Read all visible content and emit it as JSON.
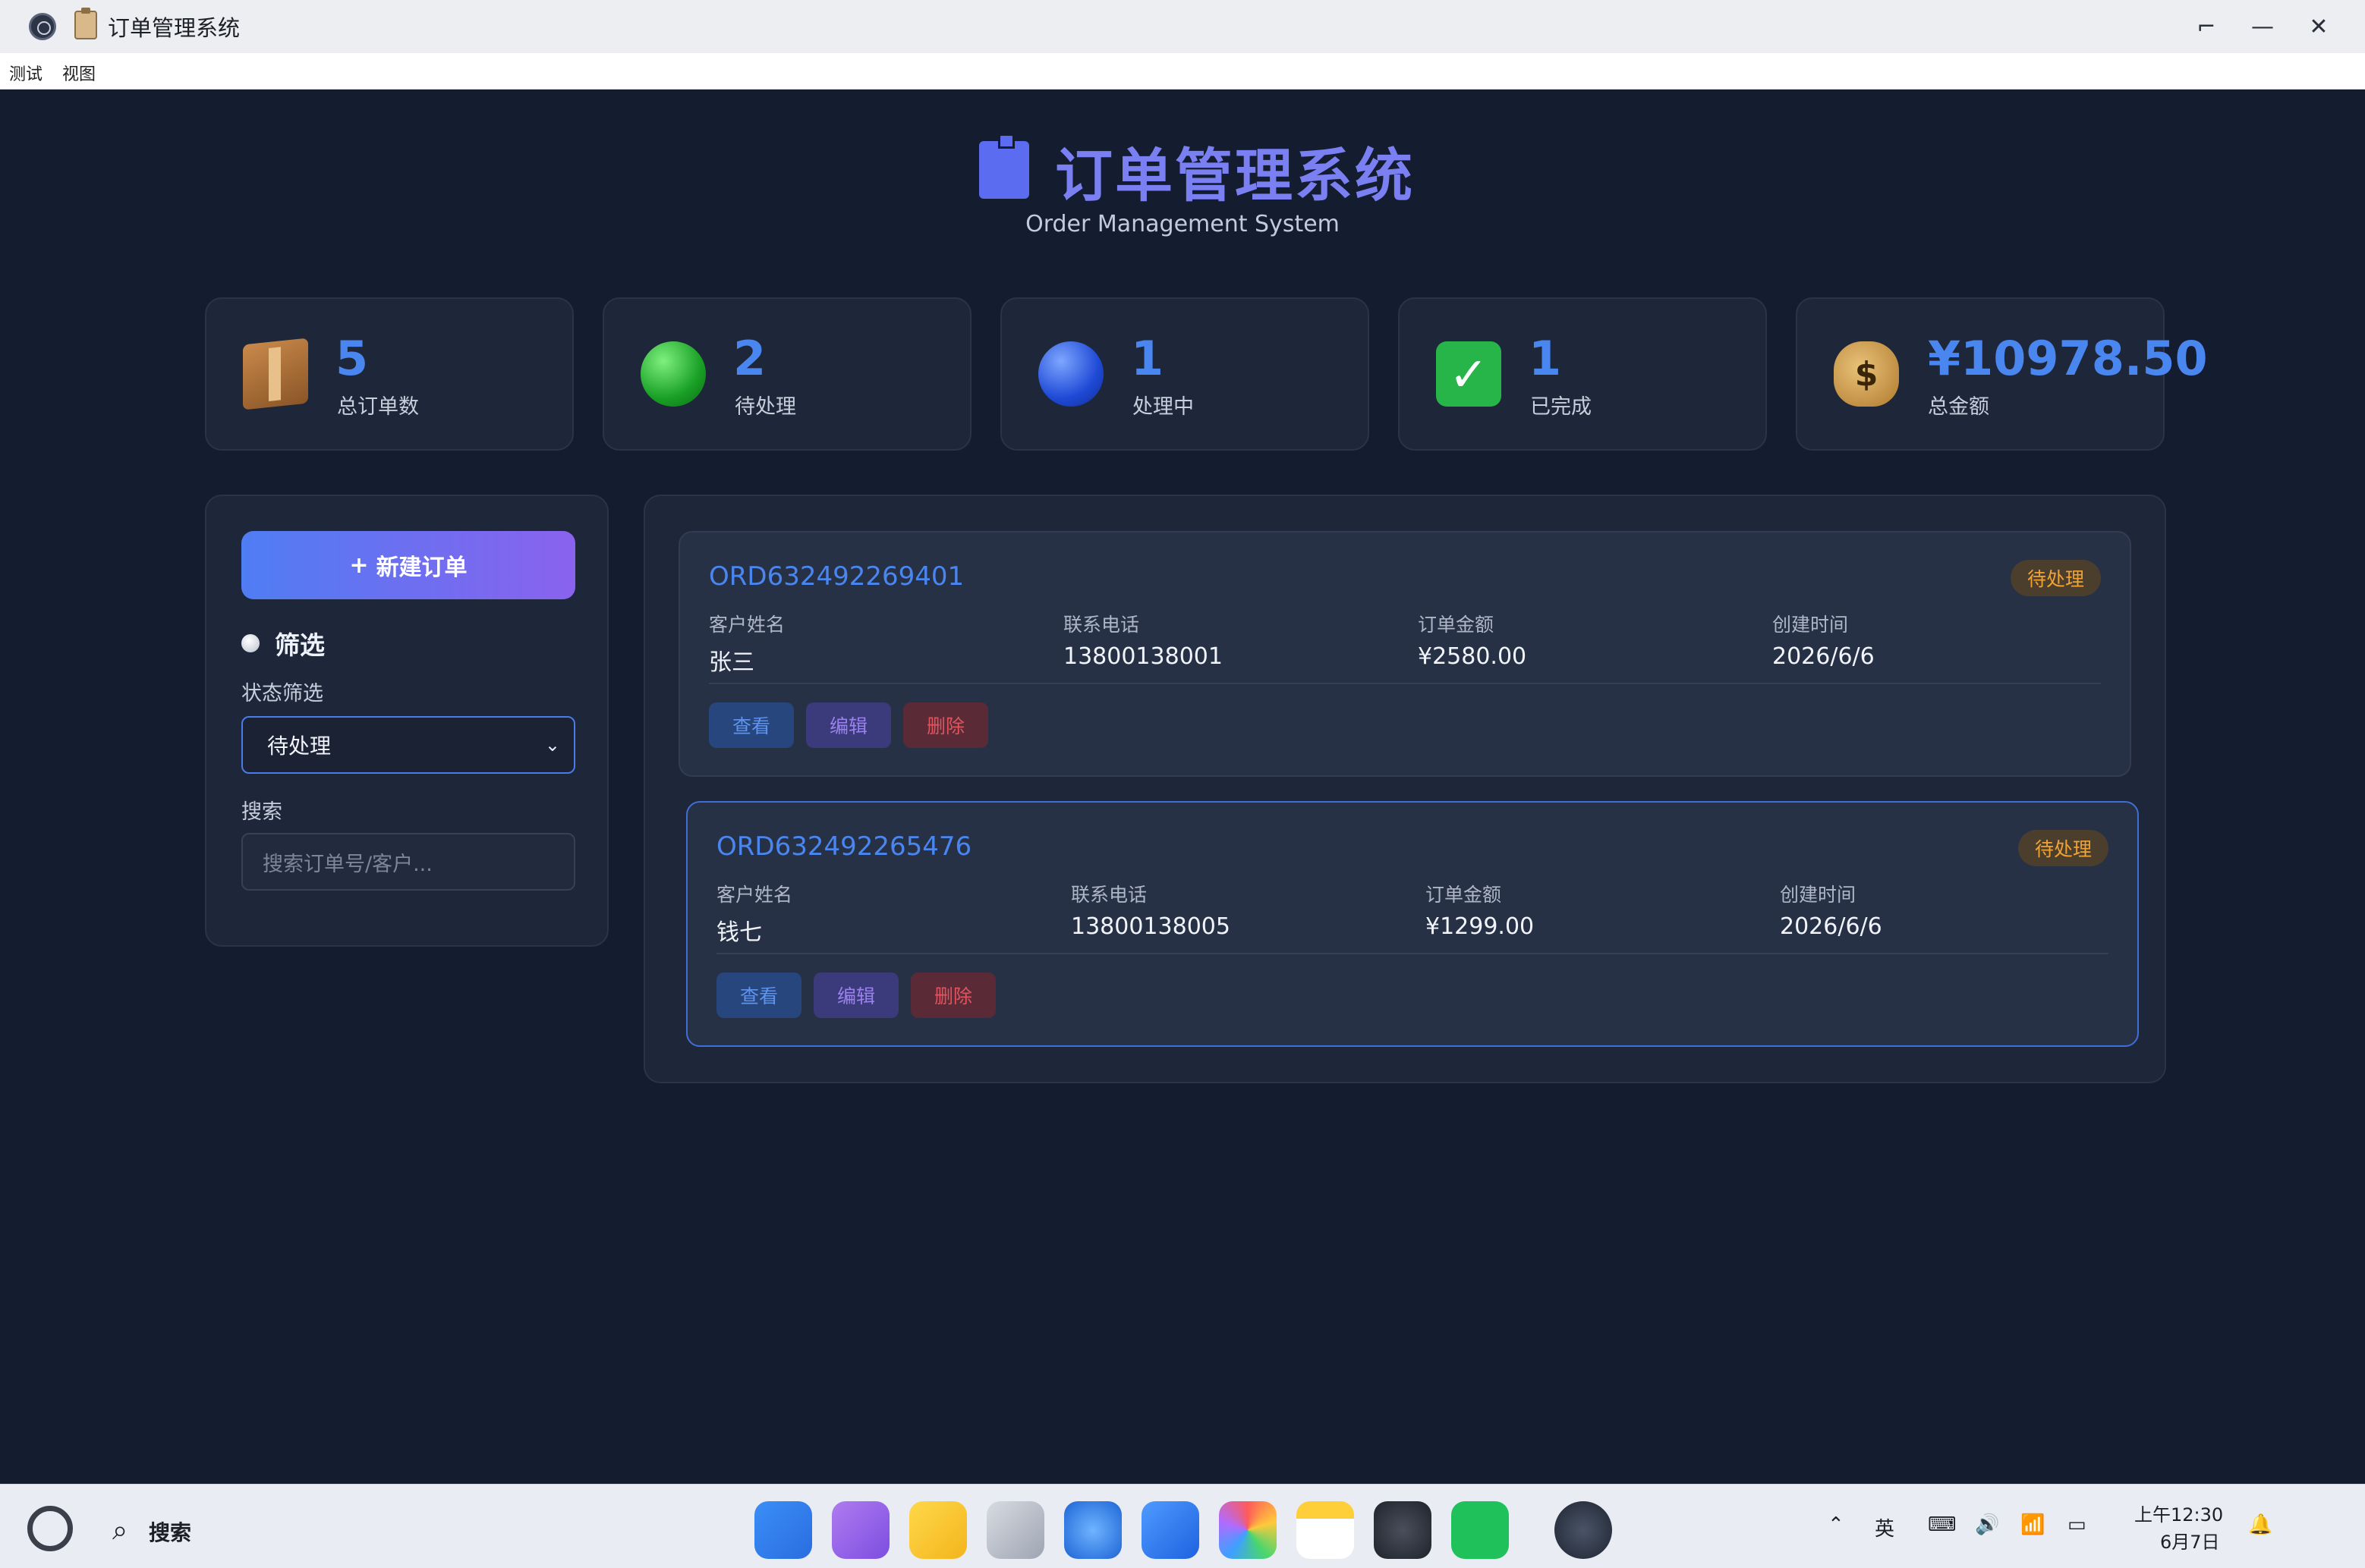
{
  "window": {
    "title": "订单管理系统",
    "menu": [
      "测试",
      "视图"
    ],
    "controls": {
      "restore": "⌐",
      "minimize": "—",
      "close": "✕"
    }
  },
  "header": {
    "title": "订单管理系统",
    "subtitle": "Order Management System"
  },
  "stats": [
    {
      "value": "5",
      "label": "总订单数",
      "icon": "package-icon"
    },
    {
      "value": "2",
      "label": "待处理",
      "icon": "green-circle-icon"
    },
    {
      "value": "1",
      "label": "处理中",
      "icon": "blue-circle-icon"
    },
    {
      "value": "1",
      "label": "已完成",
      "icon": "check-mark-icon"
    },
    {
      "value": "¥10978.50",
      "label": "总金额",
      "icon": "money-bag-icon"
    }
  ],
  "sidebar": {
    "new_order_label": "新建订单",
    "new_order_plus": "+",
    "filter_title": "筛选",
    "status_filter_label": "状态筛选",
    "status_filter_value": "待处理",
    "search_label": "搜索",
    "search_placeholder": "搜索订单号/客户..."
  },
  "orders": [
    {
      "id": "ORD632492269401",
      "status": "待处理",
      "fields": [
        {
          "label": "客户姓名",
          "value": "张三"
        },
        {
          "label": "联系电话",
          "value": "13800138001"
        },
        {
          "label": "订单金额",
          "value": "¥2580.00"
        },
        {
          "label": "创建时间",
          "value": "2026/6/6"
        }
      ],
      "actions": {
        "view": "查看",
        "edit": "编辑",
        "delete": "删除"
      }
    },
    {
      "id": "ORD632492265476",
      "status": "待处理",
      "fields": [
        {
          "label": "客户姓名",
          "value": "钱七"
        },
        {
          "label": "联系电话",
          "value": "13800138005"
        },
        {
          "label": "订单金额",
          "value": "¥1299.00"
        },
        {
          "label": "创建时间",
          "value": "2026/6/6"
        }
      ],
      "actions": {
        "view": "查看",
        "edit": "编辑",
        "delete": "删除"
      }
    }
  ],
  "taskbar": {
    "search_label": "搜索",
    "dock_apps": [
      "app-launcher-icon",
      "multitask-icon",
      "files-icon",
      "trash-icon",
      "browser-icon",
      "mail-icon",
      "photos-icon",
      "notes-icon",
      "settings-icon",
      "wechat-icon",
      "electron-app-icon"
    ],
    "tray": {
      "ime": "英",
      "time": "上午12:30",
      "date": "6月7日"
    }
  },
  "colors": {
    "background": "#141c30",
    "card": "#1e2739",
    "accent_blue": "#4a86f0",
    "accent_purple": "#7a7ff2",
    "pending": "#f0a334"
  }
}
